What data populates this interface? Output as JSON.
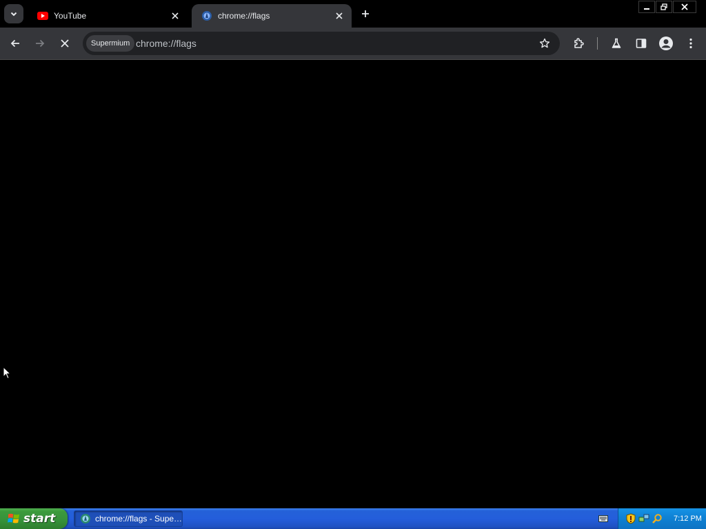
{
  "tabs": [
    {
      "title": "YouTube",
      "icon": "youtube-icon",
      "active": false
    },
    {
      "title": "chrome://flags",
      "icon": "supermium-icon",
      "active": true
    }
  ],
  "toolbar": {
    "site_chip": "Supermium",
    "url": "chrome://flags"
  },
  "taskbar": {
    "start_label": "start",
    "task_item_title": "chrome://flags - Supe…",
    "clock": "7:12 PM"
  },
  "colors": {
    "toolbar_bg": "#35363a",
    "tab_bg": "#000000",
    "omnibox_bg": "#202124",
    "taskbar_blue": "#245edb",
    "start_green": "#3c9a3c",
    "youtube_red": "#ff0000",
    "accent_blue": "#8ab4f8"
  }
}
